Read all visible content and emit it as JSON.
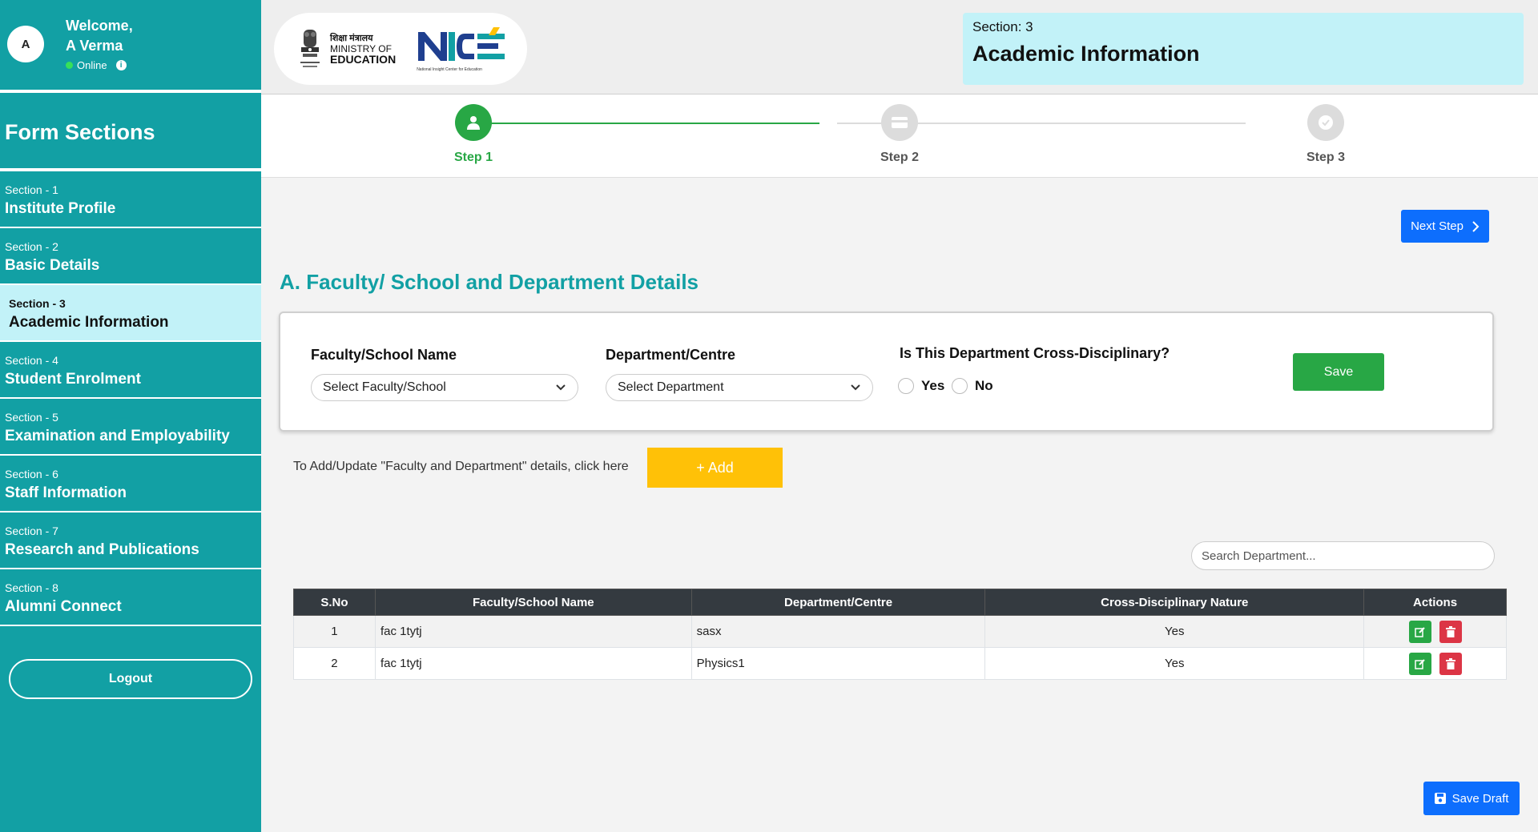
{
  "user": {
    "avatar_initial": "A",
    "welcome": "Welcome,",
    "name": "A Verma",
    "status": "Online"
  },
  "sidebar": {
    "title": "Form Sections",
    "items": [
      {
        "section": "Section - 1",
        "label": "Institute Profile"
      },
      {
        "section": "Section - 2",
        "label": "Basic Details"
      },
      {
        "section": "Section - 3",
        "label": "Academic Information"
      },
      {
        "section": "Section - 4",
        "label": "Student Enrolment"
      },
      {
        "section": "Section - 5",
        "label": "Examination and Employability"
      },
      {
        "section": "Section - 6",
        "label": "Staff Information"
      },
      {
        "section": "Section - 7",
        "label": "Research and Publications"
      },
      {
        "section": "Section - 8",
        "label": "Alumni Connect"
      }
    ],
    "active_index": 2,
    "logout_label": "Logout"
  },
  "header": {
    "ministry_hindi": "शिक्षा मंत्रालय",
    "ministry_line2": "MINISTRY OF",
    "ministry_line3": "EDUCATION",
    "nice_tagline": "National Insight Center for Education",
    "section_number": "Section: 3",
    "section_title": "Academic Information"
  },
  "stepper": {
    "steps": [
      {
        "label": "Step 1",
        "state": "active"
      },
      {
        "label": "Step 2",
        "state": "pending"
      },
      {
        "label": "Step 3",
        "state": "pending"
      }
    ]
  },
  "main": {
    "next_step_label": "Next Step",
    "section_heading": "A. Faculty/ School and Department Details",
    "form": {
      "faculty_label": "Faculty/School Name",
      "faculty_value": "Select Faculty/School",
      "department_label": "Department/Centre",
      "department_value": "Select Department",
      "cross_label": "Is This Department Cross-Disciplinary?",
      "yes_label": "Yes",
      "no_label": "No",
      "save_label": "Save"
    },
    "add_hint": "To Add/Update \"Faculty and Department\" details, click here",
    "add_label": "+ Add",
    "search_placeholder": "Search Department...",
    "table": {
      "headers": [
        "S.No",
        "Faculty/School Name",
        "Department/Centre",
        "Cross-Disciplinary Nature",
        "Actions"
      ],
      "rows": [
        {
          "sno": "1",
          "faculty": "fac 1tytj",
          "department": "sasx",
          "cross": "Yes"
        },
        {
          "sno": "2",
          "faculty": "fac 1tytj",
          "department": "Physics1",
          "cross": "Yes"
        }
      ]
    },
    "save_draft_label": "Save Draft"
  },
  "colors": {
    "teal": "#12a0a4",
    "light_cyan": "#c2f2f8",
    "green": "#28a745",
    "blue": "#0d6efd",
    "yellow": "#ffc107",
    "red": "#dc3545",
    "table_header": "#343a40"
  }
}
